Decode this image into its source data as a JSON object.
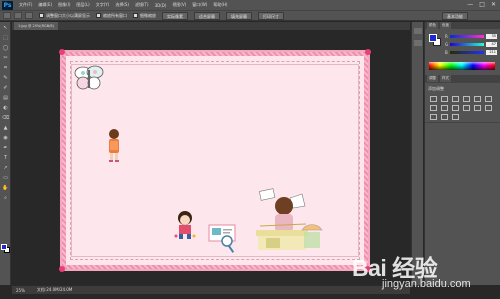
{
  "app": {
    "logo": "Ps"
  },
  "menubar": {
    "items": [
      "文件(F)",
      "编辑(E)",
      "图像(I)",
      "图层(L)",
      "文字(Y)",
      "选择(S)",
      "滤镜(T)",
      "3D(D)",
      "视图(V)",
      "窗口(W)",
      "帮助(H)"
    ],
    "window_controls": [
      "—",
      "□",
      "✕"
    ]
  },
  "options": {
    "check1_label": "调整窗口大小以满屏显示",
    "check2_label": "缩放所有窗口",
    "check3_label": "细微缩放",
    "btn_actual": "实际像素",
    "btn_fit": "适合屏幕",
    "btn_fill": "填充屏幕",
    "btn_print": "打印尺寸",
    "workspace": "基本功能"
  },
  "tools": [
    "↖",
    "⬚",
    "◯",
    "✂",
    "⌗",
    "✎",
    "✐",
    "▤",
    "◐",
    "⌫",
    "▲",
    "◉",
    "✒",
    "T",
    "↗",
    "▭",
    "✋",
    "⌕"
  ],
  "document": {
    "tab_title": "1.jpg @ 25%(RGB/8)",
    "zoom": "25%",
    "info": "文档:24.0M/24.0M"
  },
  "panels": {
    "tabs": [
      "颜色",
      "色板"
    ],
    "color": {
      "r": "35",
      "g": "47",
      "b": "211"
    },
    "adjust_tabs": [
      "调整",
      "样式"
    ],
    "adjust_title": "添加调整",
    "adjust_icon_count": 15
  },
  "colors": {
    "foreground": "#1a2ad0",
    "background": "#ffffff",
    "frame_pink": "#f4a7bf",
    "paper": "#fde7ec"
  },
  "watermark": {
    "brand": "Bai  经验",
    "url": "jingyan.baidu.com"
  }
}
